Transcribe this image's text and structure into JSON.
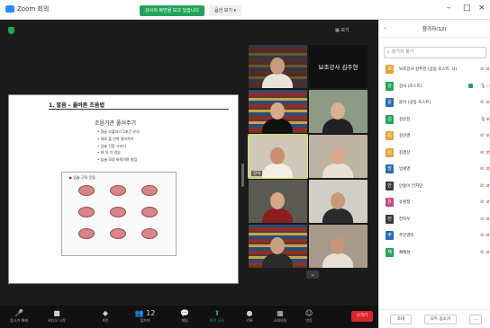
{
  "window": {
    "app_title": "Zoom 회의",
    "share_banner": "강사의 화면을 보고 있습니다",
    "view_options": "옵션 보기 ▾",
    "controls": {
      "minimize": "–",
      "maximize": "□",
      "close": "×"
    }
  },
  "meeting": {
    "view_label": "▦ 보기",
    "slide": {
      "title": "1. 발음 – 올바른 조음법",
      "subtitle": "조음기관 풀어주기",
      "bullets": [
        "• 얼굴 부풀리기 5초간 유지",
        "• 혀로 볼 안쪽 밀어주기",
        "• 입술 진동 시키기",
        "• 혀 차 기 연습",
        "• 입술 모양 바꿔가며 발음"
      ],
      "grid_title": "▶ 입술 근육 운동"
    },
    "gallery": [
      {
        "name": ""
      },
      {
        "name": "보조강사 김주현"
      },
      {
        "name": ""
      },
      {
        "name": ""
      },
      {
        "name": "강사"
      },
      {
        "name": ""
      },
      {
        "name": ""
      },
      {
        "name": ""
      },
      {
        "name": ""
      },
      {
        "name": ""
      }
    ],
    "nameplate": "보조강사 김주현"
  },
  "toolbar": {
    "items": [
      {
        "icon": "mic-off-icon",
        "glyph": "🎤",
        "label": "음소거 해제"
      },
      {
        "icon": "video-off-icon",
        "glyph": "■",
        "label": "비디오 시작"
      },
      {
        "icon": "shield-icon",
        "glyph": "◆",
        "label": "보안"
      },
      {
        "icon": "participants-icon",
        "glyph": "👥 12",
        "label": "참가자"
      },
      {
        "icon": "chat-icon",
        "glyph": "💬",
        "label": "채팅"
      },
      {
        "icon": "share-screen-icon",
        "glyph": "⬆",
        "label": "화면 공유"
      },
      {
        "icon": "record-icon",
        "glyph": "●",
        "label": "기록"
      },
      {
        "icon": "breakout-rooms-icon",
        "glyph": "▦",
        "label": "소회의실"
      },
      {
        "icon": "reactions-icon",
        "glyph": "☺",
        "label": "반응"
      }
    ],
    "leave": "나가기"
  },
  "participants": {
    "title": "참가자(12)",
    "search_placeholder": "참가자 찾기",
    "rows": [
      {
        "initial": "보",
        "name": "보조강사 김주현 (공동 호스트, 나)",
        "color": "#e8a33c",
        "mic": "off",
        "video": "off"
      },
      {
        "initial": "강",
        "name": "강사 (호스트)",
        "color": "#23a35a",
        "mic": "on",
        "video": "on"
      },
      {
        "initial": "윤",
        "name": "윤아 (공동 호스트)",
        "color": "#2b6cb0",
        "mic": "off",
        "video": "off"
      },
      {
        "initial": "김",
        "name": "김유진",
        "color": "#23a35a",
        "mic": "on",
        "video": "off"
      },
      {
        "initial": "김",
        "name": "김신영",
        "color": "#e8a33c",
        "mic": "off",
        "video": "off"
      },
      {
        "initial": "김",
        "name": "김경선",
        "color": "#e8a33c",
        "mic": "off",
        "video": "off"
      },
      {
        "initial": "방",
        "name": "방세영",
        "color": "#2b6cb0",
        "mic": "off",
        "video": "off"
      },
      {
        "initial": "안",
        "name": "안용이 안지민",
        "color": "#3a3a3a",
        "mic": "off",
        "video": "off"
      },
      {
        "initial": "유",
        "name": "유원정",
        "color": "#c44a8a",
        "mic": "off",
        "video": "off"
      },
      {
        "initial": "전",
        "name": "전지우",
        "color": "#3a3a3a",
        "mic": "off",
        "video": "off"
      },
      {
        "initial": "주",
        "name": "주인영미",
        "color": "#2b6cb0",
        "mic": "off",
        "video": "off"
      },
      {
        "initial": "채",
        "name": "채예성",
        "color": "#23a35a",
        "mic": "off",
        "video": "off"
      }
    ],
    "footer": {
      "invite": "초대",
      "mute_all": "모두 음소거",
      "more": "..."
    }
  }
}
